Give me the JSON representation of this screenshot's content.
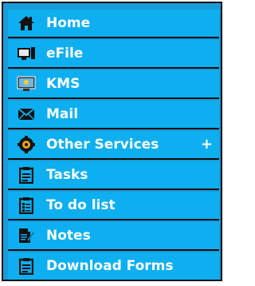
{
  "colors": {
    "item_bg": "#0daff0",
    "panel_bg": "#1a9bd8",
    "border": "#0a0a0a",
    "text": "#ffffff"
  },
  "menu": {
    "items": [
      {
        "label": "Home",
        "icon": "home-icon"
      },
      {
        "label": "eFile",
        "icon": "efile-icon"
      },
      {
        "label": "KMS",
        "icon": "kms-icon"
      },
      {
        "label": "Mail",
        "icon": "mail-icon"
      },
      {
        "label": "Other Services",
        "icon": "services-icon",
        "expand": "+"
      },
      {
        "label": "Tasks",
        "icon": "clipboard-icon"
      },
      {
        "label": "To do list",
        "icon": "checklist-icon"
      },
      {
        "label": "Notes",
        "icon": "notes-icon"
      },
      {
        "label": "Download Forms",
        "icon": "clipboard-icon"
      }
    ]
  }
}
